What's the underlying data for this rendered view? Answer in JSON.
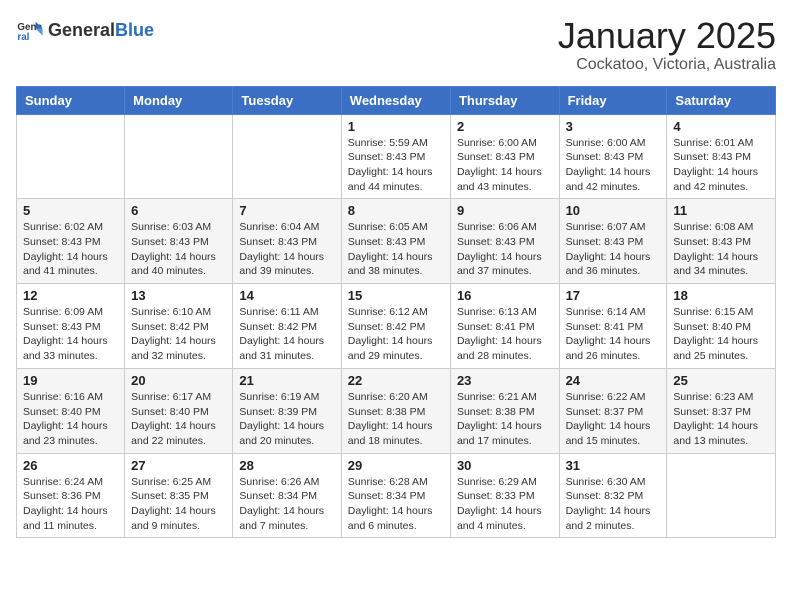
{
  "header": {
    "logo_general": "General",
    "logo_blue": "Blue",
    "title": "January 2025",
    "subtitle": "Cockatoo, Victoria, Australia"
  },
  "calendar": {
    "days_of_week": [
      "Sunday",
      "Monday",
      "Tuesday",
      "Wednesday",
      "Thursday",
      "Friday",
      "Saturday"
    ],
    "weeks": [
      [
        {
          "day": "",
          "info": ""
        },
        {
          "day": "",
          "info": ""
        },
        {
          "day": "",
          "info": ""
        },
        {
          "day": "1",
          "info": "Sunrise: 5:59 AM\nSunset: 8:43 PM\nDaylight: 14 hours\nand 44 minutes."
        },
        {
          "day": "2",
          "info": "Sunrise: 6:00 AM\nSunset: 8:43 PM\nDaylight: 14 hours\nand 43 minutes."
        },
        {
          "day": "3",
          "info": "Sunrise: 6:00 AM\nSunset: 8:43 PM\nDaylight: 14 hours\nand 42 minutes."
        },
        {
          "day": "4",
          "info": "Sunrise: 6:01 AM\nSunset: 8:43 PM\nDaylight: 14 hours\nand 42 minutes."
        }
      ],
      [
        {
          "day": "5",
          "info": "Sunrise: 6:02 AM\nSunset: 8:43 PM\nDaylight: 14 hours\nand 41 minutes."
        },
        {
          "day": "6",
          "info": "Sunrise: 6:03 AM\nSunset: 8:43 PM\nDaylight: 14 hours\nand 40 minutes."
        },
        {
          "day": "7",
          "info": "Sunrise: 6:04 AM\nSunset: 8:43 PM\nDaylight: 14 hours\nand 39 minutes."
        },
        {
          "day": "8",
          "info": "Sunrise: 6:05 AM\nSunset: 8:43 PM\nDaylight: 14 hours\nand 38 minutes."
        },
        {
          "day": "9",
          "info": "Sunrise: 6:06 AM\nSunset: 8:43 PM\nDaylight: 14 hours\nand 37 minutes."
        },
        {
          "day": "10",
          "info": "Sunrise: 6:07 AM\nSunset: 8:43 PM\nDaylight: 14 hours\nand 36 minutes."
        },
        {
          "day": "11",
          "info": "Sunrise: 6:08 AM\nSunset: 8:43 PM\nDaylight: 14 hours\nand 34 minutes."
        }
      ],
      [
        {
          "day": "12",
          "info": "Sunrise: 6:09 AM\nSunset: 8:43 PM\nDaylight: 14 hours\nand 33 minutes."
        },
        {
          "day": "13",
          "info": "Sunrise: 6:10 AM\nSunset: 8:42 PM\nDaylight: 14 hours\nand 32 minutes."
        },
        {
          "day": "14",
          "info": "Sunrise: 6:11 AM\nSunset: 8:42 PM\nDaylight: 14 hours\nand 31 minutes."
        },
        {
          "day": "15",
          "info": "Sunrise: 6:12 AM\nSunset: 8:42 PM\nDaylight: 14 hours\nand 29 minutes."
        },
        {
          "day": "16",
          "info": "Sunrise: 6:13 AM\nSunset: 8:41 PM\nDaylight: 14 hours\nand 28 minutes."
        },
        {
          "day": "17",
          "info": "Sunrise: 6:14 AM\nSunset: 8:41 PM\nDaylight: 14 hours\nand 26 minutes."
        },
        {
          "day": "18",
          "info": "Sunrise: 6:15 AM\nSunset: 8:40 PM\nDaylight: 14 hours\nand 25 minutes."
        }
      ],
      [
        {
          "day": "19",
          "info": "Sunrise: 6:16 AM\nSunset: 8:40 PM\nDaylight: 14 hours\nand 23 minutes."
        },
        {
          "day": "20",
          "info": "Sunrise: 6:17 AM\nSunset: 8:40 PM\nDaylight: 14 hours\nand 22 minutes."
        },
        {
          "day": "21",
          "info": "Sunrise: 6:19 AM\nSunset: 8:39 PM\nDaylight: 14 hours\nand 20 minutes."
        },
        {
          "day": "22",
          "info": "Sunrise: 6:20 AM\nSunset: 8:38 PM\nDaylight: 14 hours\nand 18 minutes."
        },
        {
          "day": "23",
          "info": "Sunrise: 6:21 AM\nSunset: 8:38 PM\nDaylight: 14 hours\nand 17 minutes."
        },
        {
          "day": "24",
          "info": "Sunrise: 6:22 AM\nSunset: 8:37 PM\nDaylight: 14 hours\nand 15 minutes."
        },
        {
          "day": "25",
          "info": "Sunrise: 6:23 AM\nSunset: 8:37 PM\nDaylight: 14 hours\nand 13 minutes."
        }
      ],
      [
        {
          "day": "26",
          "info": "Sunrise: 6:24 AM\nSunset: 8:36 PM\nDaylight: 14 hours\nand 11 minutes."
        },
        {
          "day": "27",
          "info": "Sunrise: 6:25 AM\nSunset: 8:35 PM\nDaylight: 14 hours\nand 9 minutes."
        },
        {
          "day": "28",
          "info": "Sunrise: 6:26 AM\nSunset: 8:34 PM\nDaylight: 14 hours\nand 7 minutes."
        },
        {
          "day": "29",
          "info": "Sunrise: 6:28 AM\nSunset: 8:34 PM\nDaylight: 14 hours\nand 6 minutes."
        },
        {
          "day": "30",
          "info": "Sunrise: 6:29 AM\nSunset: 8:33 PM\nDaylight: 14 hours\nand 4 minutes."
        },
        {
          "day": "31",
          "info": "Sunrise: 6:30 AM\nSunset: 8:32 PM\nDaylight: 14 hours\nand 2 minutes."
        },
        {
          "day": "",
          "info": ""
        }
      ]
    ]
  }
}
